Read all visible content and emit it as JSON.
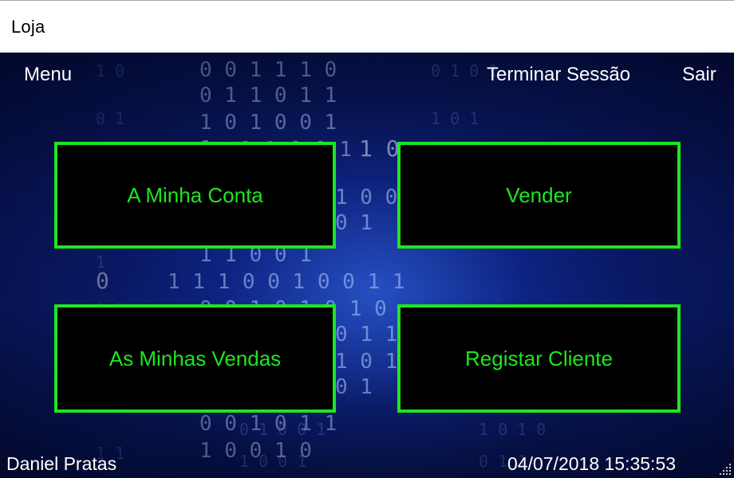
{
  "window": {
    "title": "Loja"
  },
  "menu": {
    "left_label": "Menu",
    "end_session_label": "Terminar Sessão",
    "exit_label": "Sair"
  },
  "actions": {
    "my_account": "A Minha Conta",
    "sell": "Vender",
    "my_sales": "As Minhas Vendas",
    "register_client": "Registar Cliente"
  },
  "status": {
    "user": "Daniel Pratas",
    "datetime": "04/07/2018 15:35:53"
  },
  "colors": {
    "accent_green": "#1ee61e",
    "button_bg": "#000000",
    "background_blue": "#0b1f78"
  }
}
